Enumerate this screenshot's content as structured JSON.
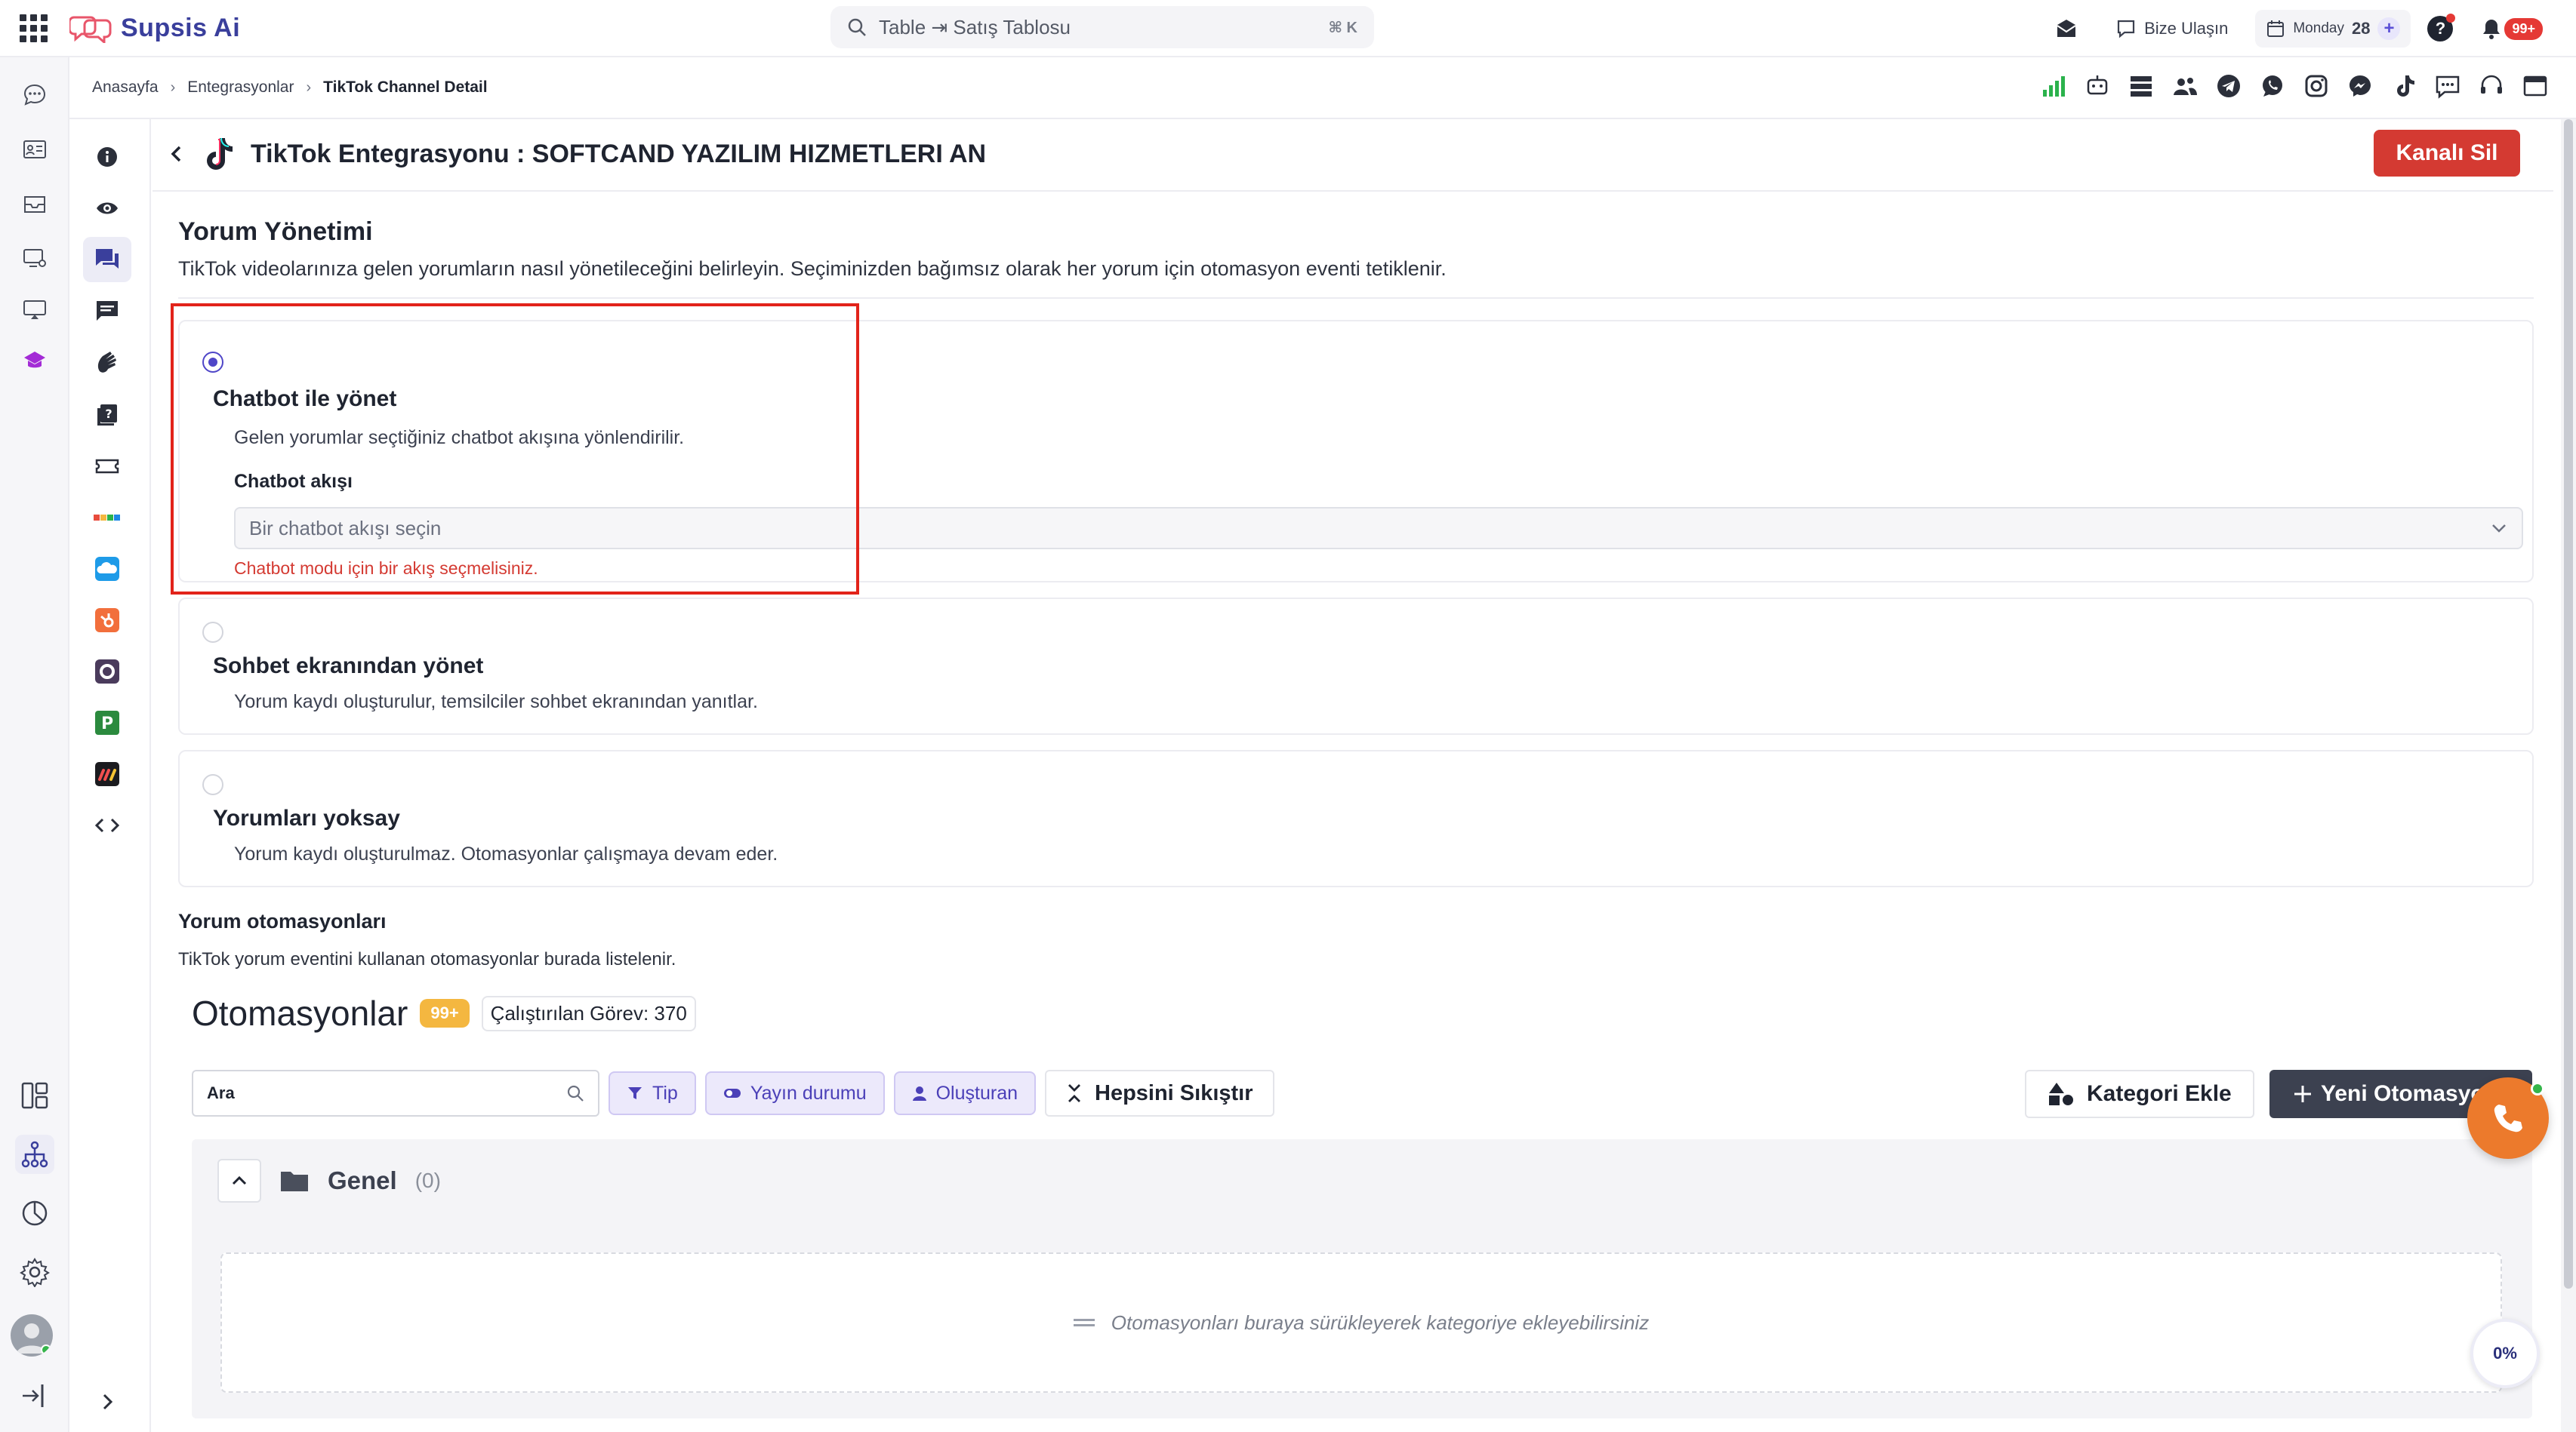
{
  "app": {
    "name": "Supsis Ai"
  },
  "search": {
    "text": "Table ⇥ Satış Tablosu",
    "shortcut": "⌘ K"
  },
  "topbar": {
    "contact_label": "Bize Ulaşın",
    "date_day": "Monday",
    "date_num": "28",
    "notif_badge": "99+",
    "brand_color": "#3a3f9c"
  },
  "breadcrumb": [
    "Anasayfa",
    "Entegrasyonlar",
    "TikTok Channel Detail"
  ],
  "page": {
    "title": "TikTok Entegrasyonu : SOFTCAND YAZILIM HIZMETLERI AN",
    "delete_label": "Kanalı Sil",
    "danger_color": "#d43a32"
  },
  "comment_mgmt": {
    "title": "Yorum Yönetimi",
    "description": "TikTok videolarınıza gelen yorumların nasıl yönetileceğini belirleyin. Seçiminizden bağımsız olarak her yorum için otomasyon eventi tetiklenir.",
    "options": [
      {
        "title": "Chatbot ile yönet",
        "description": "Gelen yorumlar seçtiğiniz chatbot akışına yönlendirilir.",
        "selected": true,
        "field_label": "Chatbot akışı",
        "placeholder": "Bir chatbot akışı seçin",
        "error": "Chatbot modu için bir akış seçmelisiniz."
      },
      {
        "title": "Sohbet ekranından yönet",
        "description": "Yorum kaydı oluşturulur, temsilciler sohbet ekranından yanıtlar.",
        "selected": false
      },
      {
        "title": "Yorumları yoksay",
        "description": "Yorum kaydı oluşturulmaz. Otomasyonlar çalışmaya devam eder.",
        "selected": false
      }
    ]
  },
  "automations": {
    "section_title": "Yorum otomasyonları",
    "section_desc": "TikTok yorum eventini kullanan otomasyonlar burada listelenir.",
    "title": "Otomasyonlar",
    "count_badge": "99+",
    "tasks_label": "Çalıştırılan Görev: 370",
    "search_value": "Ara",
    "filters": [
      "Tip",
      "Yayın durumu",
      "Oluşturan"
    ],
    "collapse_label": "Hepsini Sıkıştır",
    "add_category_label": "Kategori Ekle",
    "new_label": "Yeni Otomasyon",
    "group": {
      "name": "Genel",
      "count": "(0)"
    },
    "dropzone_text": "Otomasyonları buraya sürükleyerek kategoriye ekleyebilirsiniz"
  },
  "progress_label": "0%",
  "icons": {
    "rail": [
      "chat-icon",
      "contact-card-icon",
      "inbox-icon",
      "monitor-settings-icon",
      "screen-icon",
      "school-icon"
    ],
    "rail_bottom": [
      "dashboard-icon",
      "flow-icon",
      "reports-icon",
      "settings-icon",
      "avatar",
      "logout-icon"
    ],
    "channels": [
      "signal-icon",
      "bot-icon",
      "server-icon",
      "users-icon",
      "telegram-icon",
      "whatsapp-icon",
      "instagram-icon",
      "messenger-icon",
      "tiktok-icon",
      "sms-icon",
      "support-icon",
      "window-icon"
    ],
    "subnav": [
      "info-icon",
      "eye-icon",
      "comments-icon",
      "message-icon",
      "hand-icon",
      "question-book-icon",
      "ticket-icon",
      "trello-icon",
      "cloud-icon",
      "hubspot-icon",
      "circle-app-icon",
      "p-app-icon",
      "monday-icon",
      "code-icon"
    ]
  }
}
